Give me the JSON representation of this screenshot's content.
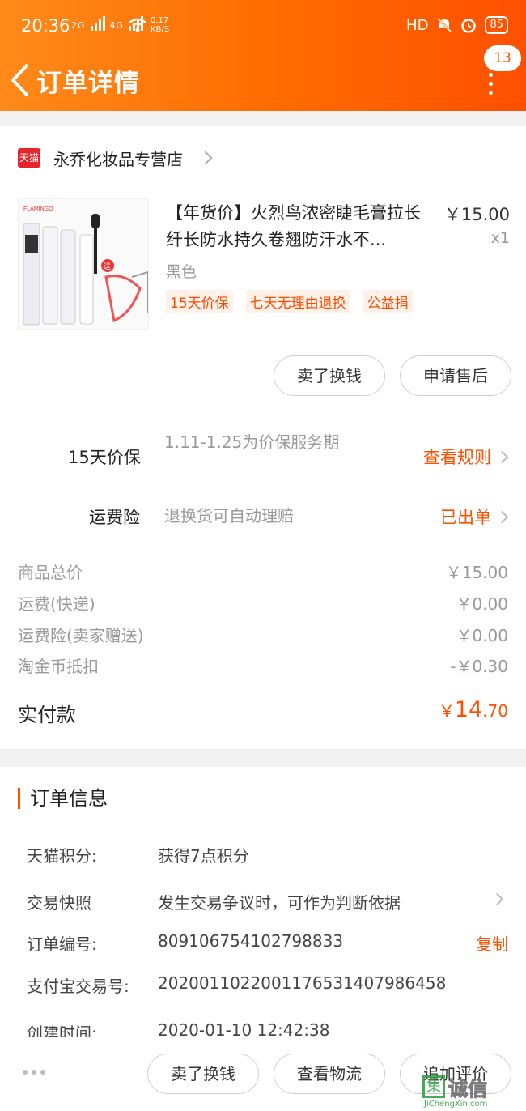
{
  "status_bar": {
    "time": "20:36",
    "net1": "2G",
    "net2": "4G",
    "speed_value": "0.17",
    "speed_unit": "KB/S",
    "hd": "HD",
    "battery": "85"
  },
  "navbar": {
    "title": "订单详情",
    "badge_count": "13"
  },
  "shop": {
    "platform_label": "天猫",
    "name": "永乔化妆品专营店"
  },
  "product": {
    "title": "【年货价】火烈鸟浓密睫毛膏拉长纤长防水持久卷翘防汗水不...",
    "price": "￥15.00",
    "qty": "x1",
    "sku": "黑色",
    "tags": [
      "15天价保",
      "七天无理由退换",
      "公益捐"
    ],
    "image_brand": "FLAMINGO",
    "image_gift": "送"
  },
  "product_actions": {
    "sell_label": "卖了换钱",
    "after_sale_label": "申请售后"
  },
  "services": [
    {
      "label": "15天价保",
      "desc": "1.11-1.25为价保服务期",
      "link": "查看规则"
    },
    {
      "label": "运费险",
      "desc": "退换货可自动理赔",
      "link": "已出单"
    }
  ],
  "fees": [
    {
      "label": "商品总价",
      "value": "￥15.00"
    },
    {
      "label": "运费(快递)",
      "value": "￥0.00"
    },
    {
      "label": "运费险(卖家赠送)",
      "value": "￥0.00"
    },
    {
      "label": "淘金币抵扣",
      "value": "-￥0.30"
    }
  ],
  "paid": {
    "label": "实付款",
    "currency": "￥",
    "integer": "14",
    "decimal": ".70"
  },
  "order_info": {
    "title": "订单信息",
    "rows": [
      {
        "label": "天猫积分:",
        "value": "获得7点积分"
      },
      {
        "label": "交易快照",
        "value": "发生交易争议时，可作为判断依据"
      },
      {
        "label": "订单编号:",
        "value": "809106754102798833",
        "action": "复制"
      },
      {
        "label": "支付宝交易号:",
        "value": "2020011022001176531407986458"
      },
      {
        "label": "创建时间:",
        "value": "2020-01-10 12:42:38"
      }
    ]
  },
  "bottom_bar": {
    "sell_label": "卖了换钱",
    "logistics_label": "查看物流",
    "review_label": "追加评价"
  },
  "watermark": {
    "box": "集",
    "text": "诚信",
    "sub": "JiChengXin.com"
  },
  "colors": {
    "accent": "#ff5000",
    "header_gradient_start": "#ff8a1a",
    "tag_bg": "#fff0e8"
  }
}
